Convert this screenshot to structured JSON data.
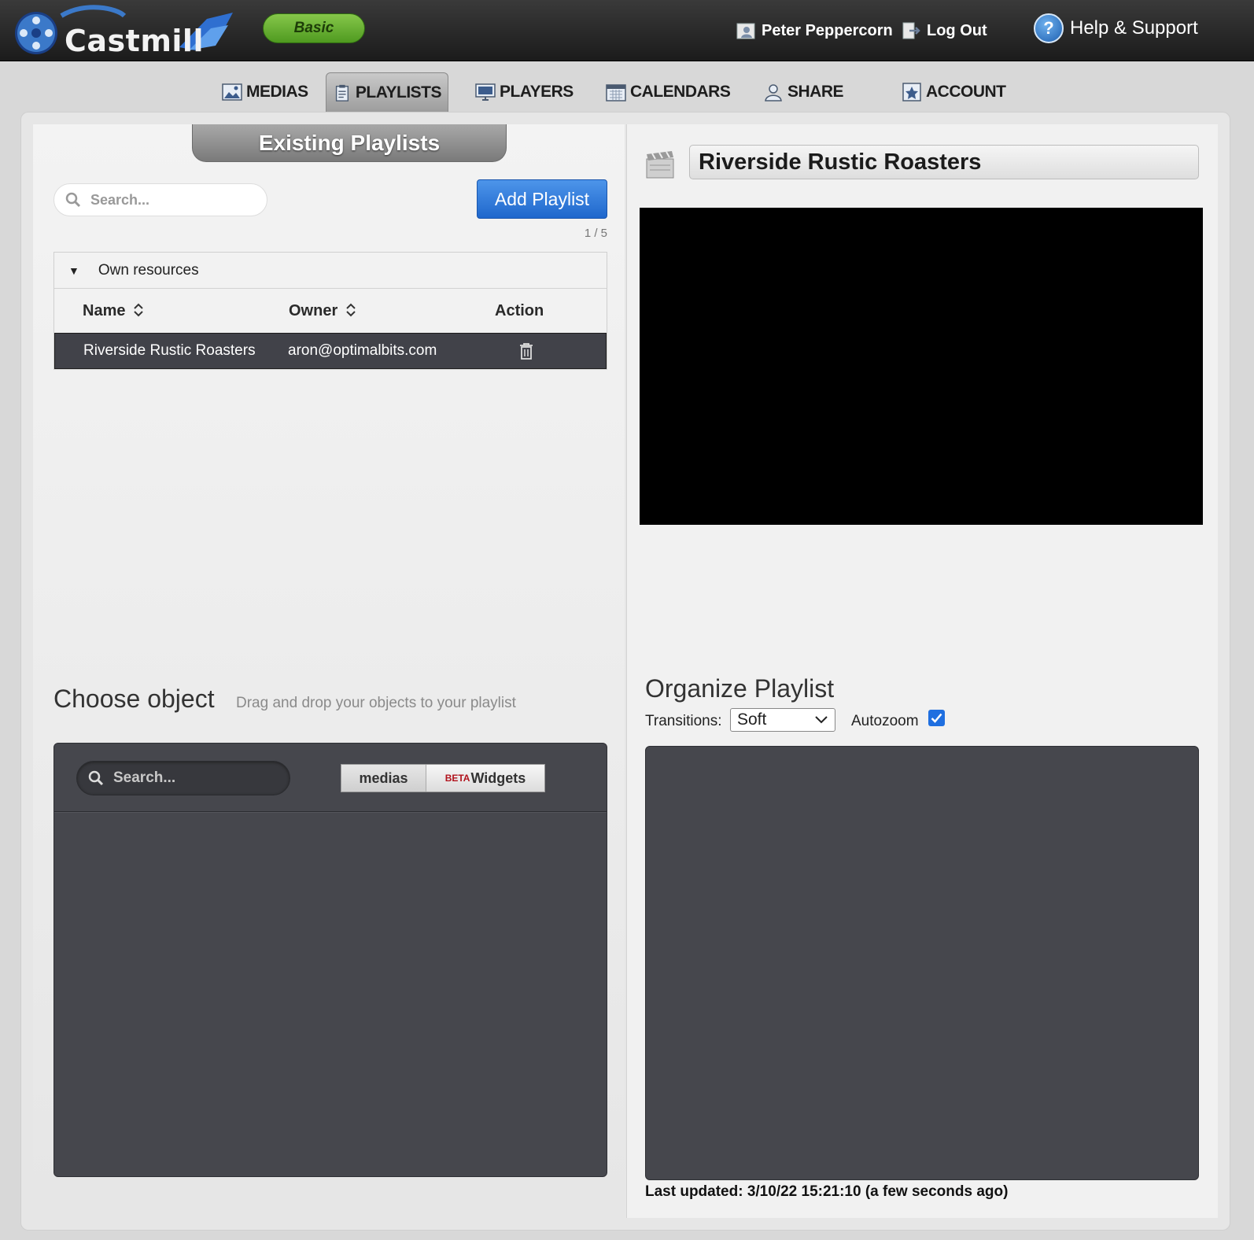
{
  "header": {
    "logo_text": "Castmill",
    "plan": "Basic",
    "user_name": "Peter Peppercorn",
    "logout_label": "Log Out",
    "help_label": "Help & Support",
    "help_glyph": "?"
  },
  "nav": {
    "items": [
      {
        "label": "MEDIAS",
        "icon": "image-icon"
      },
      {
        "label": "PLAYLISTS",
        "icon": "clipboard-icon",
        "active": true
      },
      {
        "label": "PLAYERS",
        "icon": "monitor-icon"
      },
      {
        "label": "CALENDARS",
        "icon": "calendar-icon"
      },
      {
        "label": "SHARE",
        "icon": "users-icon"
      },
      {
        "label": "ACCOUNT",
        "icon": "star-badge-icon"
      }
    ]
  },
  "playlists": {
    "section_title": "Existing Playlists",
    "search_placeholder": "Search...",
    "add_label": "Add Playlist",
    "pager": "1 / 5",
    "group_label": "Own resources",
    "columns": {
      "name": "Name",
      "owner": "Owner",
      "action": "Action"
    },
    "rows": [
      {
        "name": "Riverside Rustic Roasters",
        "owner": "aron@optimalbits.com"
      }
    ]
  },
  "choose_object": {
    "title": "Choose object",
    "subtitle": "Drag and drop your objects to your playlist",
    "search_placeholder": "Search...",
    "tab_medias": "medias",
    "tab_beta": "BETA",
    "tab_widgets": "Widgets"
  },
  "editor": {
    "playlist_name": "Riverside Rustic Roasters",
    "organize_title": "Organize Playlist",
    "transitions_label": "Transitions:",
    "transitions_value": "Soft",
    "autozoom_label": "Autozoom",
    "autozoom_checked": true,
    "last_updated": "Last updated: 3/10/22 15:21:10 (a few seconds ago)"
  },
  "colors": {
    "topbar": "#1b1b1b",
    "plan_badge": "#4f9a20",
    "add_button": "#1f67cc",
    "dark_panel": "#46474d",
    "checkbox": "#1f6fe0"
  }
}
